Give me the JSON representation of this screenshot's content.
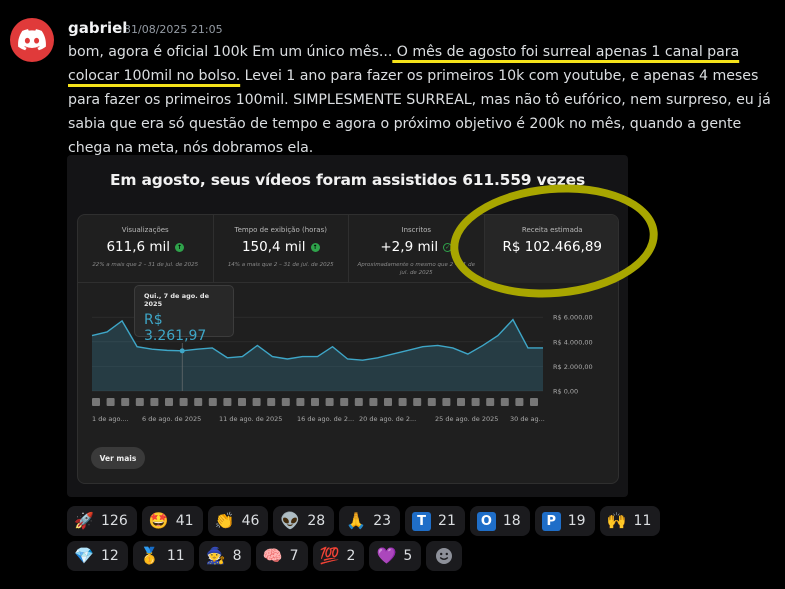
{
  "message": {
    "username": "gabriel",
    "timestamp": "31/08/2025 21:05",
    "text_before": "bom, agora é oficial 100k Em um único mês...",
    "text_highlight": " O mês de agosto foi surreal apenas 1 canal para colocar 100mil no bolso.",
    "text_after": " Levei 1 ano para fazer os primeiros 10k com youtube, e apenas 4 meses para fazer os primeiros 100mil. SIMPLESMENTE SURREAL, mas não tô eufórico, nem surpreso, eu já sabia que era só questão de tempo e agora o próximo objetivo é 200k no mês, quando a gente chega na meta, nós dobramos ela."
  },
  "embed": {
    "title": "Em agosto, seus vídeos foram assistidos 611.559 vezes",
    "metrics": [
      {
        "label": "Visualizações",
        "value": "611,6 mil",
        "icon": "up-arrow-icon",
        "sub": "22% a mais que 2 – 31 de jul. de 2025"
      },
      {
        "label": "Tempo de exibição (horas)",
        "value": "150,4 mil",
        "icon": "up-arrow-icon",
        "sub": "14% a mais que 2 – 31 de jul. de 2025"
      },
      {
        "label": "Inscritos",
        "value": "+2,9 mil",
        "icon": "check-icon",
        "sub": "Aproximadamente o mesmo que 2 – 31 de jul. de 2025"
      },
      {
        "label": "Receita estimada",
        "value": "R$ 102.466,89",
        "icon": "",
        "sub": ""
      }
    ],
    "tooltip": {
      "date": "Qui., 7 de ago. de 2025",
      "value": "R$ 3.261,97"
    },
    "button": "Ver mais",
    "accent": "#3ea6c7",
    "highlight_circle_color": "#a8a600"
  },
  "chart_data": {
    "type": "area",
    "x": [
      "1 de ago.",
      "2",
      "3",
      "4",
      "5",
      "6",
      "7",
      "8",
      "9",
      "10",
      "11",
      "12",
      "13",
      "14",
      "15",
      "16",
      "17",
      "18",
      "19",
      "20",
      "21",
      "22",
      "23",
      "24",
      "25",
      "26",
      "27",
      "28",
      "29",
      "30",
      "31"
    ],
    "x_tick_labels": [
      "1 de ago....",
      "6 de ago. de 2025",
      "11 de ago. de 2025",
      "16 de ago. de 2...",
      "20 de ago. de 2...",
      "25 de ago. de 2025",
      "30 de ag..."
    ],
    "values": [
      4500,
      4800,
      5700,
      3600,
      3400,
      3300,
      3262,
      3400,
      3500,
      2700,
      2800,
      3700,
      2800,
      2600,
      2800,
      2800,
      3600,
      2600,
      2500,
      2700,
      3000,
      3300,
      3600,
      3700,
      3500,
      3000,
      3700,
      4500,
      5800,
      3500,
      3500
    ],
    "y_ticks": [
      "R$ 6.000,00",
      "R$ 4.000,00",
      "R$ 2.000,00",
      "R$ 0,00"
    ],
    "ylim": [
      0,
      6500
    ]
  },
  "reactions": [
    {
      "emoji": "🚀",
      "count": "126"
    },
    {
      "emoji": "🤩",
      "count": "41"
    },
    {
      "emoji": "👏",
      "count": "46"
    },
    {
      "emoji": "👽",
      "count": "28"
    },
    {
      "emoji": "🙏",
      "count": "23"
    },
    {
      "letter": "T",
      "count": "21"
    },
    {
      "letter": "O",
      "count": "18"
    },
    {
      "letter": "P",
      "count": "19"
    },
    {
      "emoji": "🙌",
      "count": "11"
    },
    {
      "emoji": "💎",
      "count": "12"
    },
    {
      "emoji": "🥇",
      "count": "11"
    },
    {
      "emoji": "🧙",
      "count": "8"
    },
    {
      "emoji": "🧠",
      "count": "7"
    },
    {
      "emoji": "💯",
      "count": "2"
    },
    {
      "emoji": "💜",
      "count": "5"
    }
  ]
}
